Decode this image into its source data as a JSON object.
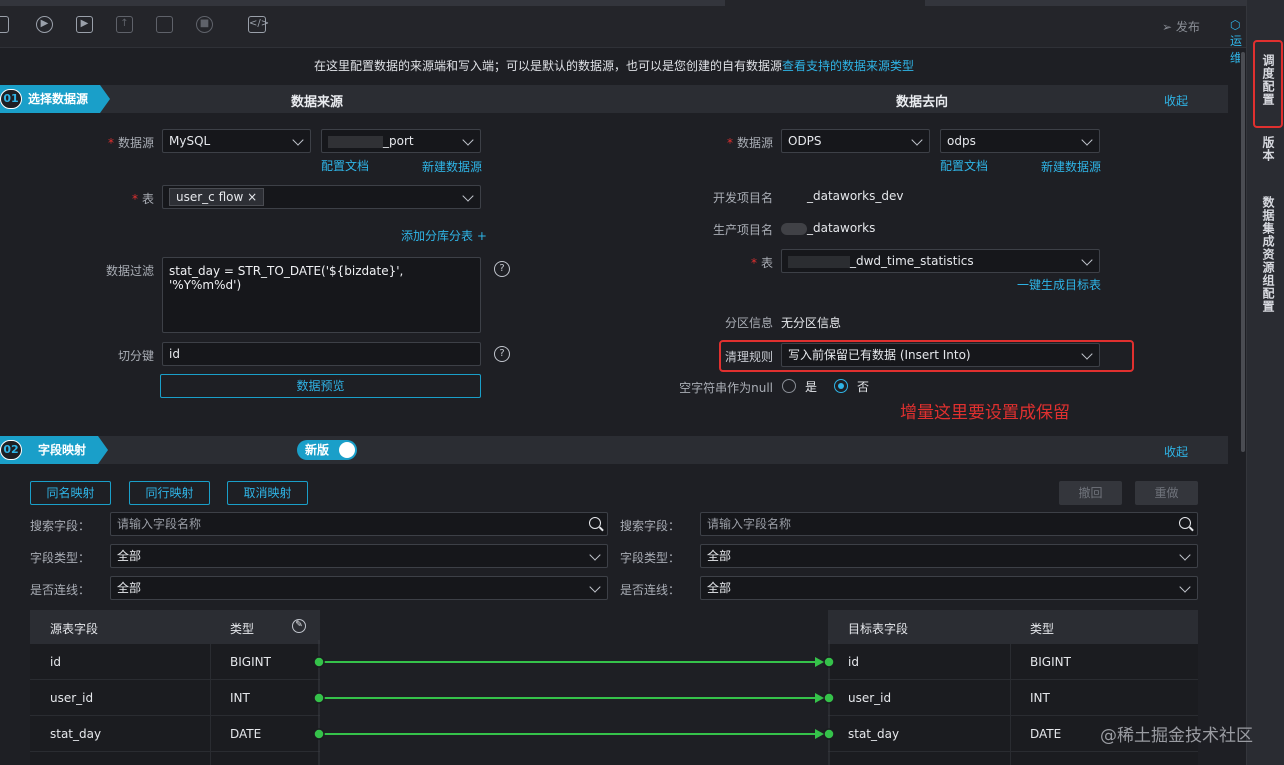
{
  "toolbar": {
    "publish_label": "发布",
    "ops_label": "运维"
  },
  "rightbar": {
    "items": [
      "调度配置",
      "版本",
      "数据集成资源组配置"
    ]
  },
  "notice": {
    "text": "在这里配置数据的来源端和写入端；可以是默认的数据源，也可以是您创建的自有数据源",
    "link": "查看支持的数据来源类型"
  },
  "step1": {
    "num": "01",
    "label": "选择数据源",
    "source_title": "数据来源",
    "target_title": "数据去向",
    "collapse": "收起"
  },
  "source": {
    "datasource_label": "数据源",
    "datasource_type": "MySQL",
    "datasource_name": "_port",
    "config_doc": "配置文档",
    "new_datasource": "新建数据源",
    "table_label": "表",
    "table_tag": "user_c          flow",
    "add_shard": "添加分库分表 +",
    "filter_label": "数据过滤",
    "filter_value": "stat_day = STR_TO_DATE('${bizdate}', '%Y%m%d')",
    "split_label": "切分键",
    "split_value": "id",
    "preview": "数据预览"
  },
  "target": {
    "datasource_label": "数据源",
    "datasource_type": "ODPS",
    "datasource_name": "odps",
    "config_doc": "配置文档",
    "new_datasource": "新建数据源",
    "dev_project_label": "开发项目名",
    "dev_project": "_dataworks_dev",
    "prod_project_label": "生产项目名",
    "prod_project": "_dataworks",
    "table_label": "表",
    "table_value": "_dwd_time_statistics",
    "gen_target": "一键生成目标表",
    "partition_label": "分区信息",
    "partition_value": "无分区信息",
    "clean_label": "清理规则",
    "clean_value": "写入前保留已有数据 (Insert Into)",
    "null_label": "空字符串作为null",
    "yes": "是",
    "no": "否",
    "annotation": "增量这里要设置成保留"
  },
  "step2": {
    "num": "02",
    "label": "字段映射",
    "toggle": "新版",
    "collapse": "收起",
    "same_name_map": "同名映射",
    "same_row_map": "同行映射",
    "cancel_map": "取消映射",
    "undo": "撤回",
    "redo": "重做"
  },
  "filters": {
    "search_label": "搜索字段：",
    "search_placeholder": "请输入字段名称",
    "type_label": "字段类型：",
    "type_value": "全部",
    "connected_label": "是否连线：",
    "connected_value": "全部"
  },
  "source_table": {
    "headers": [
      "源表字段",
      "类型"
    ],
    "rows": [
      {
        "field": "id",
        "type": "BIGINT"
      },
      {
        "field": "user_id",
        "type": "INT"
      },
      {
        "field": "stat_day",
        "type": "DATE"
      }
    ]
  },
  "target_table": {
    "headers": [
      "目标表字段",
      "类型"
    ],
    "rows": [
      {
        "field": "id",
        "type": "BIGINT"
      },
      {
        "field": "user_id",
        "type": "INT"
      },
      {
        "field": "stat_day",
        "type": "DATE"
      }
    ]
  },
  "watermark": "@稀土掘金技术社区",
  "colors": {
    "accent": "#2fb4e6",
    "mapping_line": "#35c24a",
    "annotation": "#e0302f"
  }
}
